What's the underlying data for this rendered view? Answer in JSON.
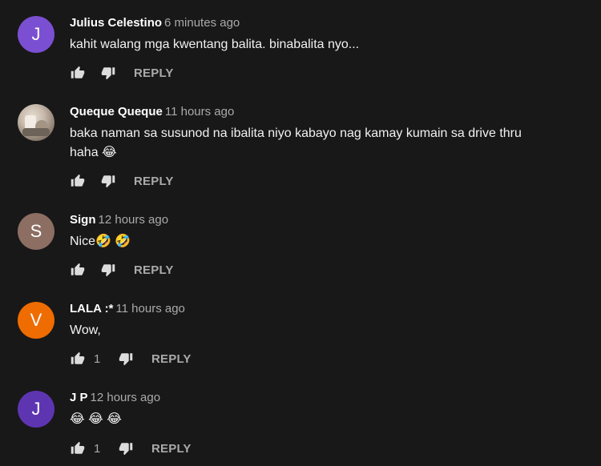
{
  "comments": [
    {
      "avatar_letter": "J",
      "avatar_color": "#7b4fd1",
      "author": "Julius Celestino",
      "time": "6 minutes ago",
      "text": "kahit walang mga kwentang balita. binabalita nyo...",
      "likes": "",
      "reply_label": "REPLY"
    },
    {
      "avatar_letter": "",
      "avatar_color": "#b8ab9c",
      "author": "Queque Queque",
      "time": "11 hours ago",
      "text": "baka naman sa susunod na ibalita niyo kabayo nag kamay kumain sa drive thru haha 😂",
      "likes": "",
      "reply_label": "REPLY"
    },
    {
      "avatar_letter": "S",
      "avatar_color": "#8d6e63",
      "author": "Sign",
      "time": "12 hours ago",
      "text": "Nice🤣 🤣",
      "likes": "",
      "reply_label": "REPLY"
    },
    {
      "avatar_letter": "V",
      "avatar_color": "#ef6c00",
      "author": "LALA :*",
      "time": "11 hours ago",
      "text": "Wow,",
      "likes": "1",
      "reply_label": "REPLY"
    },
    {
      "avatar_letter": "J",
      "avatar_color": "#5e35b1",
      "author": "J P",
      "time": "12 hours ago",
      "text": "😂 😂 😂",
      "likes": "1",
      "reply_label": "REPLY"
    }
  ],
  "icons": {
    "like": "thumb-up-icon",
    "dislike": "thumb-down-icon"
  },
  "colors": {
    "background": "#181818",
    "text": "#f1f1f1",
    "secondary": "#aaaaaa"
  }
}
